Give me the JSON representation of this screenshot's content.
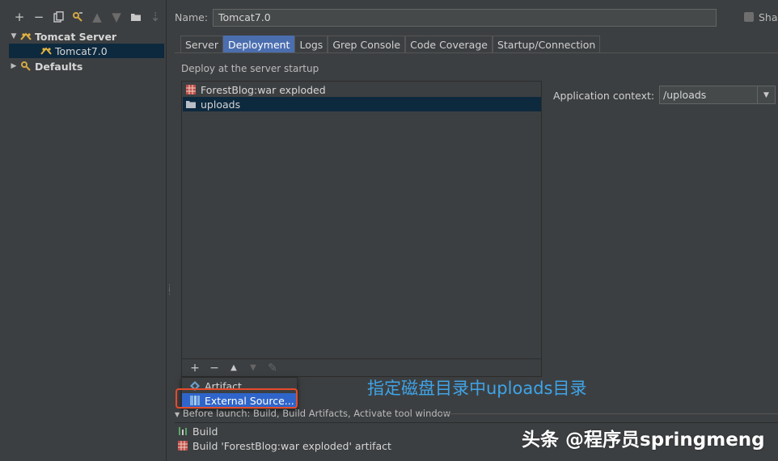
{
  "colors": {
    "background": "#3c3f41",
    "selection": "#0d293e",
    "active_tab": "#4b6eaf",
    "popup_selected": "#2f65ca",
    "highlight_box": "#e44c2c",
    "annotation": "#3fa4e8"
  },
  "left_toolbar": {
    "icons": [
      "add-icon",
      "remove-icon",
      "copy-icon",
      "edit-defaults-icon",
      "move-up-icon",
      "move-down-icon",
      "folder-icon",
      "sort-icon"
    ]
  },
  "tree": {
    "items": [
      {
        "label": "Tomcat Server",
        "icon": "tomcat-icon",
        "expanded": true
      },
      {
        "label": "Tomcat7.0",
        "icon": "tomcat-icon",
        "selected": true
      },
      {
        "label": "Defaults",
        "icon": "defaults-icon",
        "expanded": false
      }
    ]
  },
  "config": {
    "name_label": "Name:",
    "name_value": "Tomcat7.0",
    "share_label": "Sha"
  },
  "tabs": [
    {
      "label": "Server"
    },
    {
      "label": "Deployment",
      "active": true
    },
    {
      "label": "Logs"
    },
    {
      "label": "Grep Console"
    },
    {
      "label": "Code Coverage"
    },
    {
      "label": "Startup/Connection"
    }
  ],
  "deployment": {
    "title": "Deploy at the server startup",
    "items": [
      {
        "label": "ForestBlog:war exploded",
        "icon": "artifact-icon"
      },
      {
        "label": "uploads",
        "icon": "folder-icon",
        "selected": true
      }
    ],
    "context_label": "Application context:",
    "context_value": "/uploads"
  },
  "popup": {
    "items": [
      {
        "label": "Artifact...",
        "icon": "artifact-icon"
      },
      {
        "label": "External Source...",
        "icon": "external-source-icon",
        "selected": true
      }
    ]
  },
  "before_launch": {
    "title": "Before launch: Build, Build Artifacts, Activate tool window",
    "items": [
      {
        "label": "Build",
        "icon": "build-icon"
      },
      {
        "label": "Build 'ForestBlog:war exploded' artifact",
        "icon": "artifact-icon"
      }
    ]
  },
  "annotation": "指定磁盘目录中uploads目录",
  "watermark": "头条 @程序员springmeng"
}
